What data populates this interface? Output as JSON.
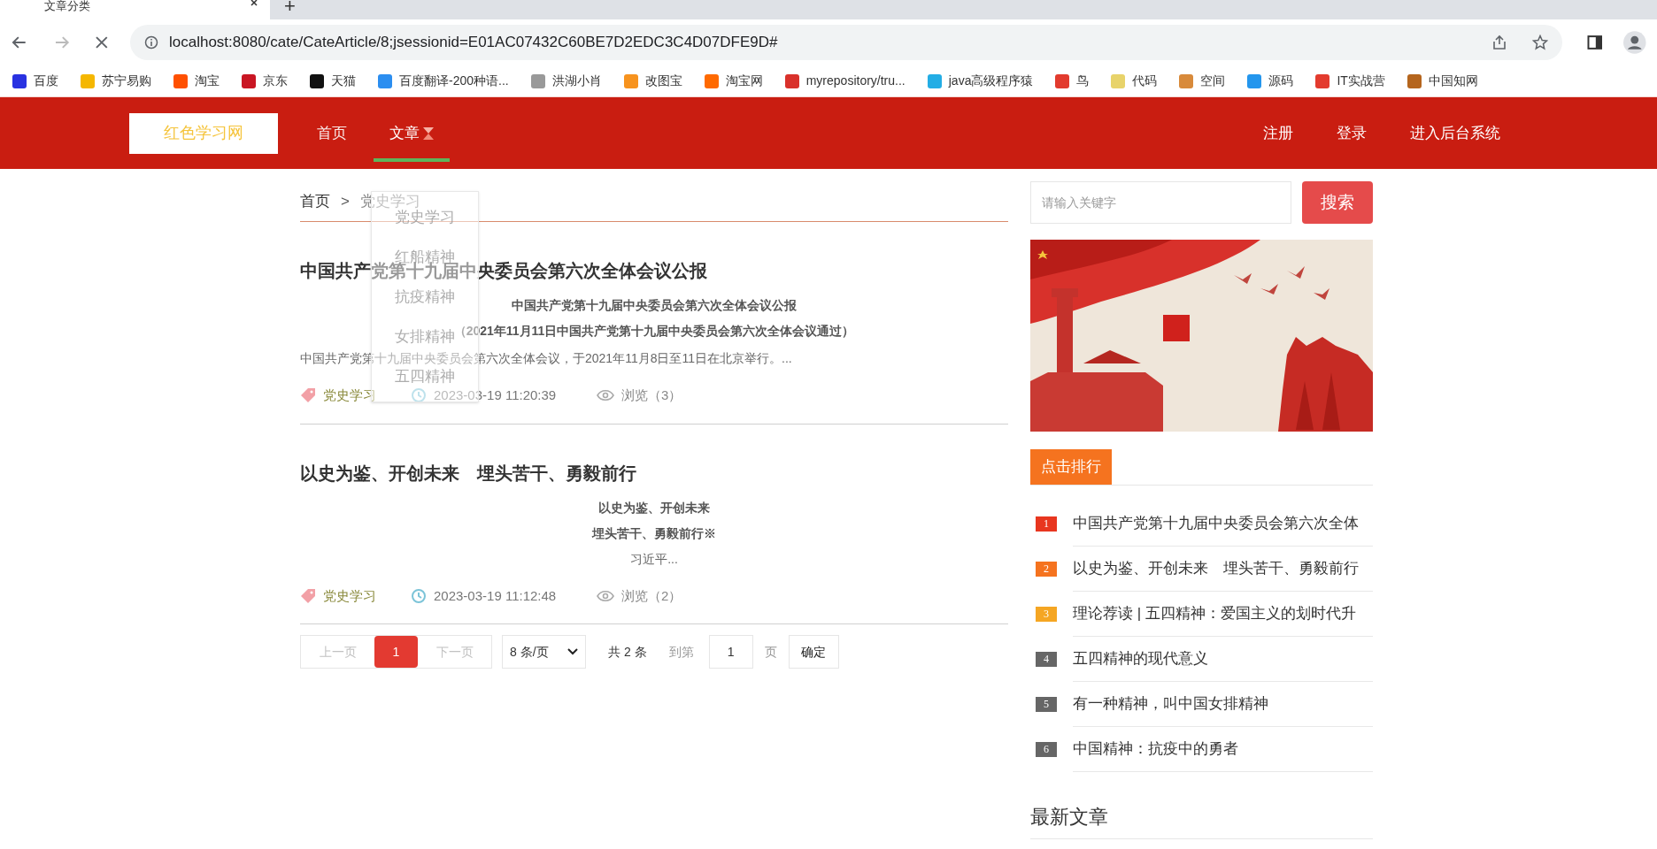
{
  "browser": {
    "tab_title": "文章分类",
    "new_tab": "+",
    "url": "localhost:8080/cate/CateArticle/8;jsessionid=E01AC07432C60BE7D2EDC3C4D07DFE9D#",
    "bookmarks": [
      {
        "label": "百度",
        "color": "#2932e1"
      },
      {
        "label": "苏宁易购",
        "color": "#f5b700"
      },
      {
        "label": "淘宝",
        "color": "#ff5000"
      },
      {
        "label": "京东",
        "color": "#c91623"
      },
      {
        "label": "天猫",
        "color": "#111111"
      },
      {
        "label": "百度翻译-200种语...",
        "color": "#2b8ef0"
      },
      {
        "label": "洪湖小肖",
        "color": "#999999"
      },
      {
        "label": "改图宝",
        "color": "#f7931e"
      },
      {
        "label": "淘宝网",
        "color": "#ff6a00"
      },
      {
        "label": "myrepository/tru...",
        "color": "#d9312b"
      },
      {
        "label": "java高级程序猿",
        "color": "#23ade5"
      },
      {
        "label": "鸟",
        "color": "#e23b2e"
      },
      {
        "label": "代码",
        "color": "#e8d36a"
      },
      {
        "label": "空间",
        "color": "#d88a3a"
      },
      {
        "label": "源码",
        "color": "#2496ed"
      },
      {
        "label": "IT实战营",
        "color": "#e33b2e"
      },
      {
        "label": "中国知网",
        "color": "#b5651d"
      }
    ]
  },
  "nav": {
    "logo": "红色学习网",
    "items": [
      {
        "label": "首页",
        "selected": false,
        "has_menu": false
      },
      {
        "label": "文章",
        "selected": true,
        "has_menu": true
      }
    ],
    "right": [
      "注册",
      "登录",
      "进入后台系统"
    ]
  },
  "dropdown": {
    "items": [
      "党史学习",
      "红船精神",
      "抗疫精神",
      "女排精神",
      "五四精神"
    ]
  },
  "breadcrumb": {
    "items": [
      "首页",
      "党史学习"
    ],
    "separator": ">"
  },
  "articles": [
    {
      "title": "中国共产党第十九届中央委员会第六次全体会议公报",
      "summary_lines": [
        "中国共产党第十九届中央委员会第六次全体会议公报",
        "（2021年11月11日中国共产党第十九届中央委员会第六次全体会议通过）"
      ],
      "excerpt": "中国共产党第十九届中央委员会第六次全体会议，于2021年11月8日至11日在北京举行。...",
      "tag": "党史学习",
      "date": "2023-03-19 11:20:39",
      "views": "浏览（3）"
    },
    {
      "title": "以史为鉴、开创未来　埋头苦干、勇毅前行",
      "summary_lines": [
        "以史为鉴、开创未来",
        "埋头苦干、勇毅前行※"
      ],
      "excerpt_centered": "习近平...",
      "tag": "党史学习",
      "date": "2023-03-19 11:12:48",
      "views": "浏览（2）"
    }
  ],
  "pagination": {
    "prev": "上一页",
    "pages": [
      {
        "label": "1",
        "selected": true
      }
    ],
    "next": "下一页",
    "page_size": "8 条/页",
    "total": "共 2 条",
    "goto": "到第",
    "goto_value": "1",
    "page_unit": "页",
    "confirm": "确定"
  },
  "sidebar": {
    "search": {
      "placeholder": "请输入关键字",
      "button": "搜索"
    },
    "ranking": {
      "title": "点击排行",
      "items": [
        {
          "rank": "1",
          "title": "中国共产党第十九届中央委员会第六次全体",
          "color": "#e8361f"
        },
        {
          "rank": "2",
          "title": "以史为鉴、开创未来　埋头苦干、勇毅前行",
          "color": "#f5731f"
        },
        {
          "rank": "3",
          "title": "理论荐读 | 五四精神：爱国主义的划时代升",
          "color": "#f5a623"
        },
        {
          "rank": "4",
          "title": "五四精神的现代意义",
          "color": "#666666"
        },
        {
          "rank": "5",
          "title": "有一种精神，叫中国女排精神",
          "color": "#666666"
        },
        {
          "rank": "6",
          "title": "中国精神：抗疫中的勇者",
          "color": "#666666"
        }
      ]
    },
    "latest_title": "最新文章"
  }
}
